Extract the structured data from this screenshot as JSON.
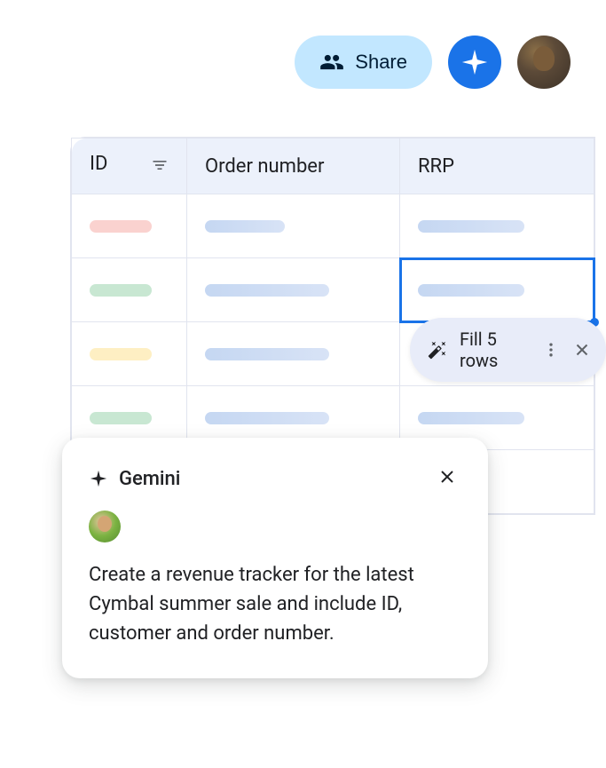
{
  "topbar": {
    "share_label": "Share"
  },
  "table": {
    "headers": {
      "id": "ID",
      "order": "Order number",
      "rrp": "RRP"
    }
  },
  "chip": {
    "label": "Fill 5 rows"
  },
  "gemini_card": {
    "title": "Gemini",
    "prompt": "Create a revenue tracker for the latest Cymbal summer sale and include ID, customer and order number."
  }
}
